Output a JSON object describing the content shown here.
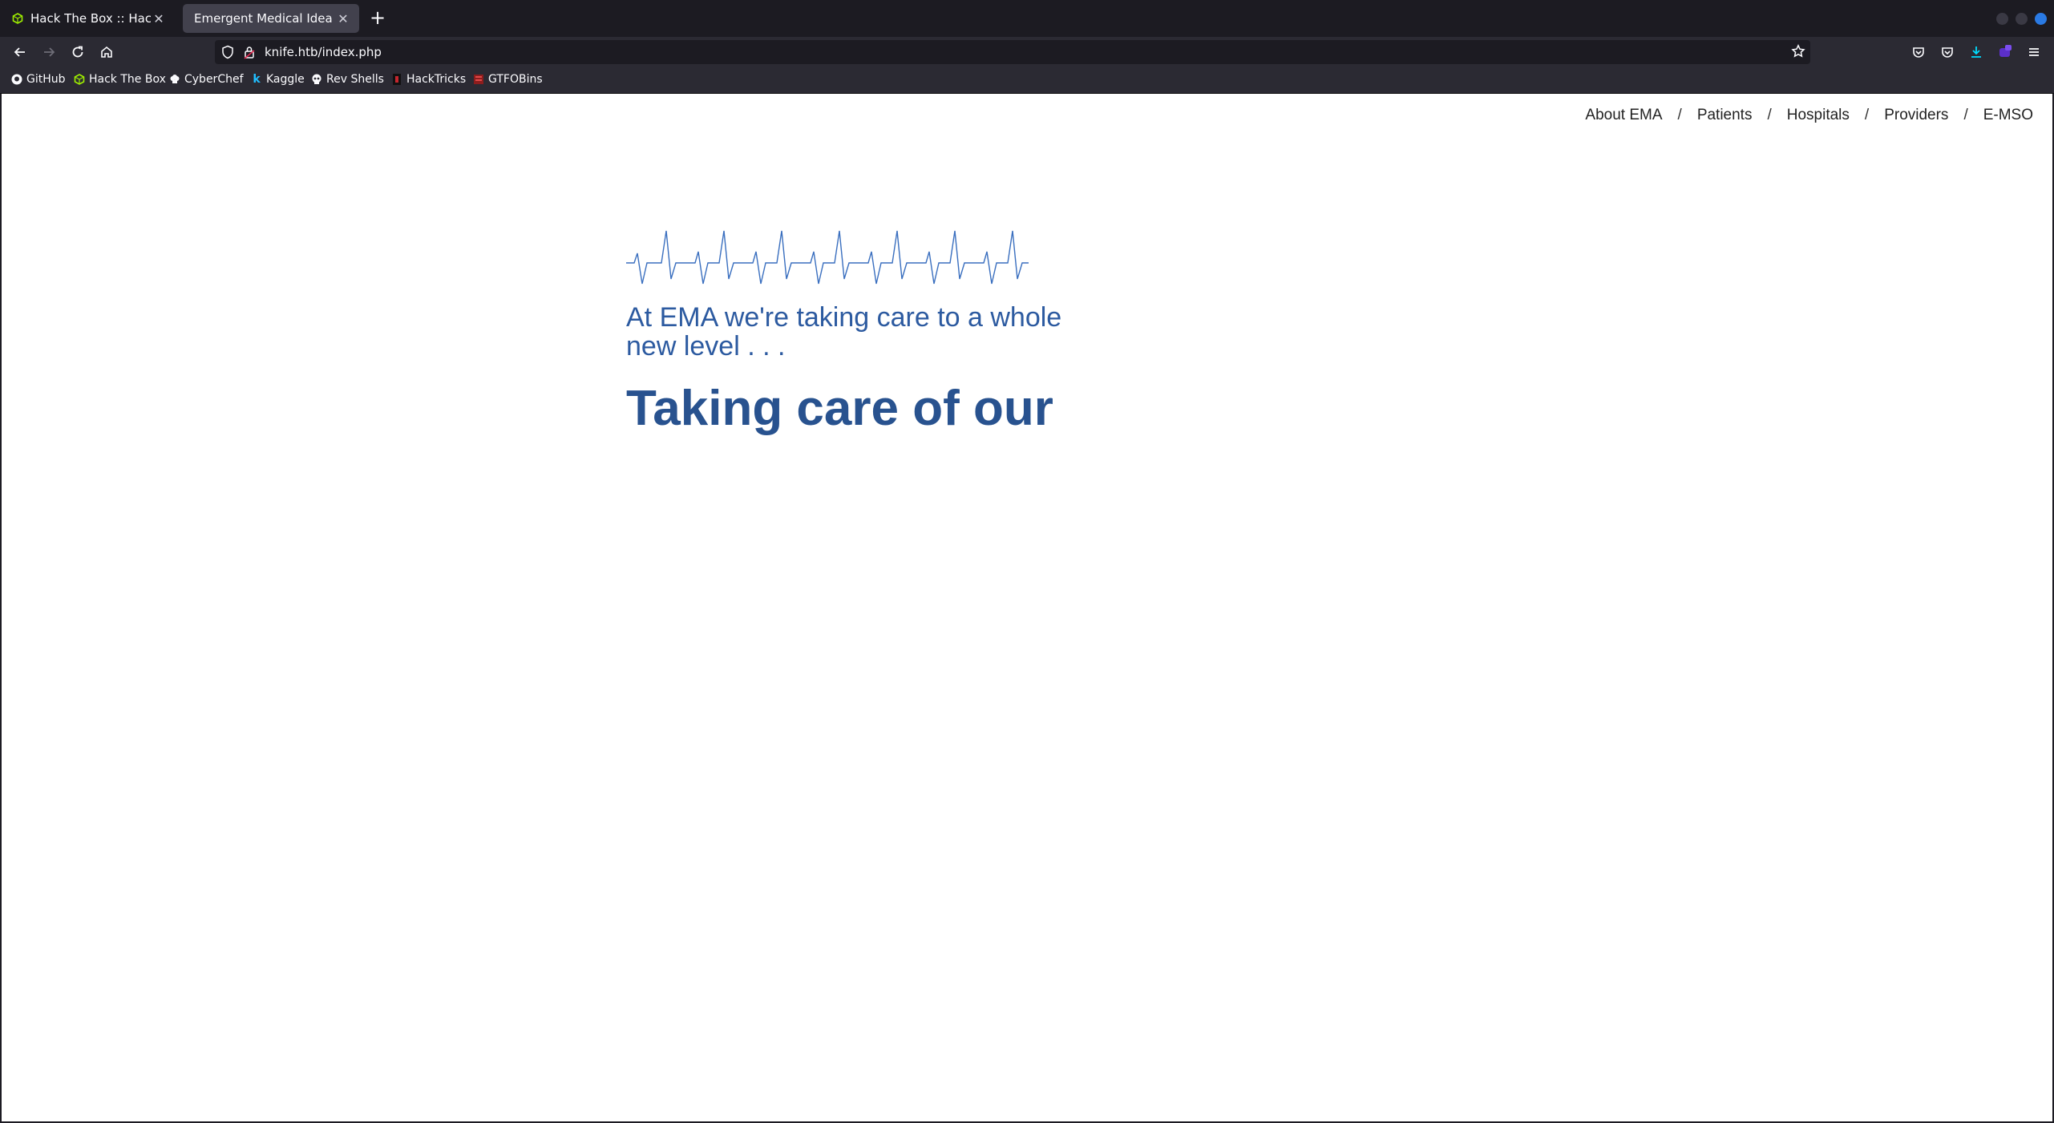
{
  "browser": {
    "tabs": [
      {
        "title": "Hack The Box :: Hack The Box",
        "active": false,
        "icon": "htb-cube-icon"
      },
      {
        "title": "Emergent Medical Idea",
        "active": true,
        "icon": "none"
      }
    ],
    "new_tab_label": "+",
    "url": "knife.htb/index.php",
    "bookmarks": [
      {
        "label": "GitHub",
        "icon": "github-icon"
      },
      {
        "label": "Hack The Box",
        "icon": "htb-cube-icon"
      },
      {
        "label": "CyberChef",
        "icon": "chef-hat-icon"
      },
      {
        "label": "Kaggle",
        "icon": "kaggle-k-icon"
      },
      {
        "label": "Rev Shells",
        "icon": "skull-icon"
      },
      {
        "label": "HackTricks",
        "icon": "hacktricks-icon"
      },
      {
        "label": "GTFOBins",
        "icon": "gtfobins-icon"
      }
    ],
    "colors": {
      "accent": "#0060df",
      "htb_green": "#9fef00"
    }
  },
  "site": {
    "nav": [
      "About EMA",
      "Patients",
      "Hospitals",
      "Providers",
      "E-MSO"
    ],
    "nav_separator": "/",
    "tagline": "At EMA we're taking care to a whole new level . . .",
    "headline": "Taking care of our",
    "colors": {
      "primary": "#2c5aa0",
      "headline": "#28528f"
    }
  }
}
